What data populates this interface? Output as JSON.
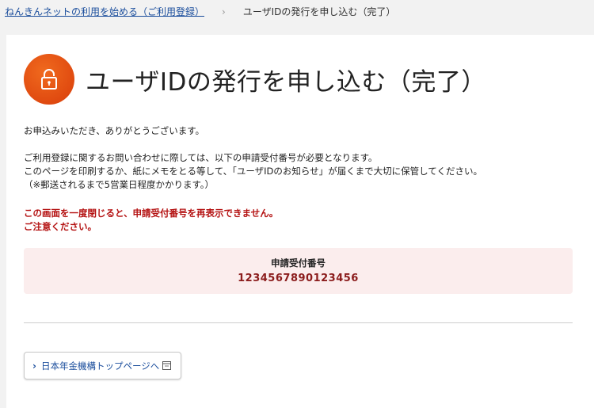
{
  "breadcrumb": {
    "parent": "ねんきんネットの利用を始める（ご利用登録）",
    "separator": "›",
    "current": "ユーザIDの発行を申し込む（完了）"
  },
  "header": {
    "title": "ユーザIDの発行を申し込む（完了）",
    "icon": "lock-icon"
  },
  "body": {
    "line1": "お申込みいただき、ありがとうございます。",
    "line2": "ご利用登録に関するお問い合わせに際しては、以下の申請受付番号が必要となります。",
    "line3": "このページを印刷するか、紙にメモをとる等して、「ユーザIDのお知らせ」が届くまで大切に保管してください。",
    "line4": "（※郵送されるまで5営業日程度かかります。）"
  },
  "warning": {
    "line1": "この画面を一度閉じると、申請受付番号を再表示できません。",
    "line2": "ご注意ください。"
  },
  "receipt": {
    "label": "申請受付番号",
    "number": "1234567890123456"
  },
  "actions": {
    "top_page_label": "日本年金機構トップページへ",
    "external_icon": "external-window-icon"
  },
  "colors": {
    "accent_orange": "#e04a10",
    "warning_red": "#b41111",
    "link_blue": "#1a4d9c",
    "receipt_bg": "#fbeded"
  }
}
